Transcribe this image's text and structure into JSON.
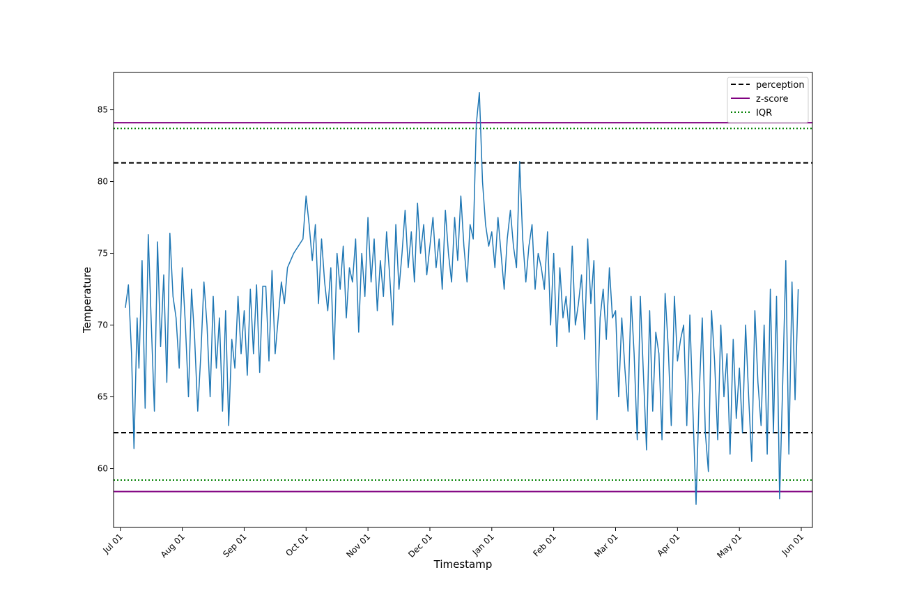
{
  "chart_data": {
    "type": "line",
    "title": "",
    "xlabel": "Timestamp",
    "ylabel": "Temperature",
    "x_ticks": [
      "Jul 01",
      "Aug 01",
      "Sep 01",
      "Oct 01",
      "Nov 01",
      "Dec 01",
      "Jan 01",
      "Feb 01",
      "Mar 01",
      "Apr 01",
      "May 01",
      "Jun 01"
    ],
    "y_ticks": [
      60,
      65,
      70,
      75,
      80,
      85
    ],
    "ylim": [
      55.9,
      87.6
    ],
    "xlim_months": [
      -0.11,
      11.18
    ],
    "grid": false,
    "legend_position": "top-right",
    "series": [
      {
        "color": "#1f77b4",
        "style": "solid",
        "x": [
          0.08,
          0.13,
          0.18,
          0.22,
          0.27,
          0.3,
          0.35,
          0.4,
          0.45,
          0.5,
          0.55,
          0.6,
          0.65,
          0.7,
          0.75,
          0.8,
          0.85,
          0.9,
          0.95,
          1.0,
          1.05,
          1.1,
          1.15,
          1.2,
          1.25,
          1.3,
          1.35,
          1.4,
          1.45,
          1.5,
          1.55,
          1.6,
          1.65,
          1.7,
          1.75,
          1.8,
          1.85,
          1.9,
          1.95,
          2.0,
          2.05,
          2.1,
          2.15,
          2.2,
          2.25,
          2.3,
          2.35,
          2.4,
          2.45,
          2.5,
          2.55,
          2.6,
          2.65,
          2.7,
          2.8,
          2.95,
          3.0,
          3.05,
          3.1,
          3.15,
          3.2,
          3.25,
          3.3,
          3.35,
          3.4,
          3.45,
          3.5,
          3.55,
          3.6,
          3.65,
          3.7,
          3.75,
          3.8,
          3.85,
          3.9,
          3.95,
          4.0,
          4.05,
          4.1,
          4.15,
          4.2,
          4.25,
          4.3,
          4.35,
          4.4,
          4.45,
          4.5,
          4.55,
          4.6,
          4.65,
          4.7,
          4.75,
          4.8,
          4.85,
          4.9,
          4.95,
          5.0,
          5.05,
          5.1,
          5.15,
          5.2,
          5.25,
          5.3,
          5.35,
          5.4,
          5.45,
          5.5,
          5.55,
          5.6,
          5.65,
          5.7,
          5.75,
          5.8,
          5.85,
          5.9,
          5.95,
          6.0,
          6.05,
          6.1,
          6.15,
          6.2,
          6.25,
          6.3,
          6.35,
          6.4,
          6.45,
          6.5,
          6.55,
          6.6,
          6.65,
          6.7,
          6.75,
          6.8,
          6.85,
          6.9,
          6.95,
          7.0,
          7.05,
          7.1,
          7.15,
          7.2,
          7.25,
          7.3,
          7.35,
          7.4,
          7.45,
          7.5,
          7.55,
          7.6,
          7.65,
          7.7,
          7.75,
          7.8,
          7.85,
          7.9,
          7.95,
          8.0,
          8.05,
          8.1,
          8.15,
          8.2,
          8.25,
          8.3,
          8.35,
          8.4,
          8.45,
          8.5,
          8.55,
          8.6,
          8.65,
          8.7,
          8.75,
          8.8,
          8.85,
          8.9,
          8.95,
          9.0,
          9.05,
          9.1,
          9.15,
          9.2,
          9.25,
          9.3,
          9.35,
          9.4,
          9.45,
          9.5,
          9.55,
          9.6,
          9.65,
          9.7,
          9.75,
          9.8,
          9.85,
          9.9,
          9.95,
          10.0,
          10.05,
          10.1,
          10.15,
          10.2,
          10.25,
          10.3,
          10.35,
          10.4,
          10.45,
          10.5,
          10.55,
          10.6,
          10.65,
          10.7,
          10.75,
          10.8,
          10.85,
          10.9,
          10.95
        ],
        "y": [
          71.2,
          72.8,
          68.0,
          61.4,
          70.5,
          67.0,
          74.5,
          64.2,
          76.3,
          70.0,
          64.0,
          75.8,
          68.5,
          73.5,
          66.0,
          76.4,
          72.0,
          70.5,
          67.0,
          74.0,
          70.0,
          65.0,
          72.5,
          69.0,
          64.0,
          68.0,
          73.0,
          70.0,
          65.0,
          72.0,
          67.0,
          70.5,
          64.0,
          71.0,
          63.0,
          69.0,
          67.0,
          72.0,
          68.0,
          71.0,
          66.5,
          72.5,
          68.0,
          72.8,
          66.7,
          72.7,
          72.7,
          67.5,
          73.8,
          68.0,
          70.5,
          73.0,
          71.5,
          74.0,
          75.0,
          76.0,
          79.0,
          77.0,
          74.5,
          77.0,
          71.5,
          76.0,
          73.0,
          71.0,
          74.0,
          67.6,
          75.0,
          72.5,
          75.5,
          70.5,
          74.0,
          73.0,
          76.0,
          69.5,
          75.0,
          72.0,
          77.5,
          73.0,
          76.0,
          71.0,
          74.5,
          72.0,
          76.5,
          73.5,
          70.0,
          77.0,
          72.5,
          75.0,
          78.0,
          74.0,
          76.5,
          73.0,
          78.5,
          75.0,
          77.0,
          73.5,
          75.5,
          77.5,
          74.0,
          76.0,
          72.5,
          78.0,
          75.0,
          73.0,
          77.5,
          74.5,
          79.0,
          75.5,
          73.0,
          77.0,
          76.0,
          84.0,
          86.2,
          80.0,
          77.0,
          75.5,
          76.5,
          74.0,
          77.5,
          75.0,
          72.5,
          76.0,
          78.0,
          75.5,
          74.0,
          81.4,
          76.0,
          73.0,
          75.5,
          77.0,
          72.5,
          75.0,
          74.0,
          72.5,
          76.5,
          70.0,
          75.0,
          68.5,
          74.0,
          70.5,
          72.0,
          69.5,
          75.5,
          70.0,
          71.5,
          73.5,
          69.0,
          76.0,
          71.5,
          74.5,
          63.4,
          70.5,
          72.5,
          69.0,
          74.0,
          70.5,
          71.0,
          65.0,
          70.5,
          67.0,
          64.0,
          72.0,
          68.0,
          62.0,
          72.0,
          66.5,
          61.3,
          71.0,
          64.0,
          69.5,
          68.0,
          62.0,
          72.2,
          68.5,
          63.0,
          72.0,
          67.5,
          69.0,
          70.0,
          63.0,
          70.7,
          64.0,
          57.5,
          65.0,
          70.5,
          62.5,
          59.8,
          71.0,
          67.5,
          62.0,
          70.0,
          65.0,
          68.0,
          61.0,
          69.0,
          63.5,
          67.0,
          62.5,
          70.0,
          65.0,
          60.5,
          71.0,
          66.0,
          63.0,
          70.0,
          61.0,
          72.5,
          62.5,
          72.0,
          57.9,
          66.0,
          74.5,
          61.0,
          73.0,
          64.8,
          72.5
        ]
      },
      {
        "name": "perception",
        "color": "#000000",
        "style": "dashed",
        "y_values": [
          81.3,
          62.5
        ]
      },
      {
        "name": "z-score",
        "color": "#800080",
        "style": "solid",
        "y_values": [
          84.1,
          58.4
        ]
      },
      {
        "name": "IQR",
        "color": "#008000",
        "style": "dotted",
        "y_values": [
          83.7,
          59.2
        ]
      }
    ]
  }
}
